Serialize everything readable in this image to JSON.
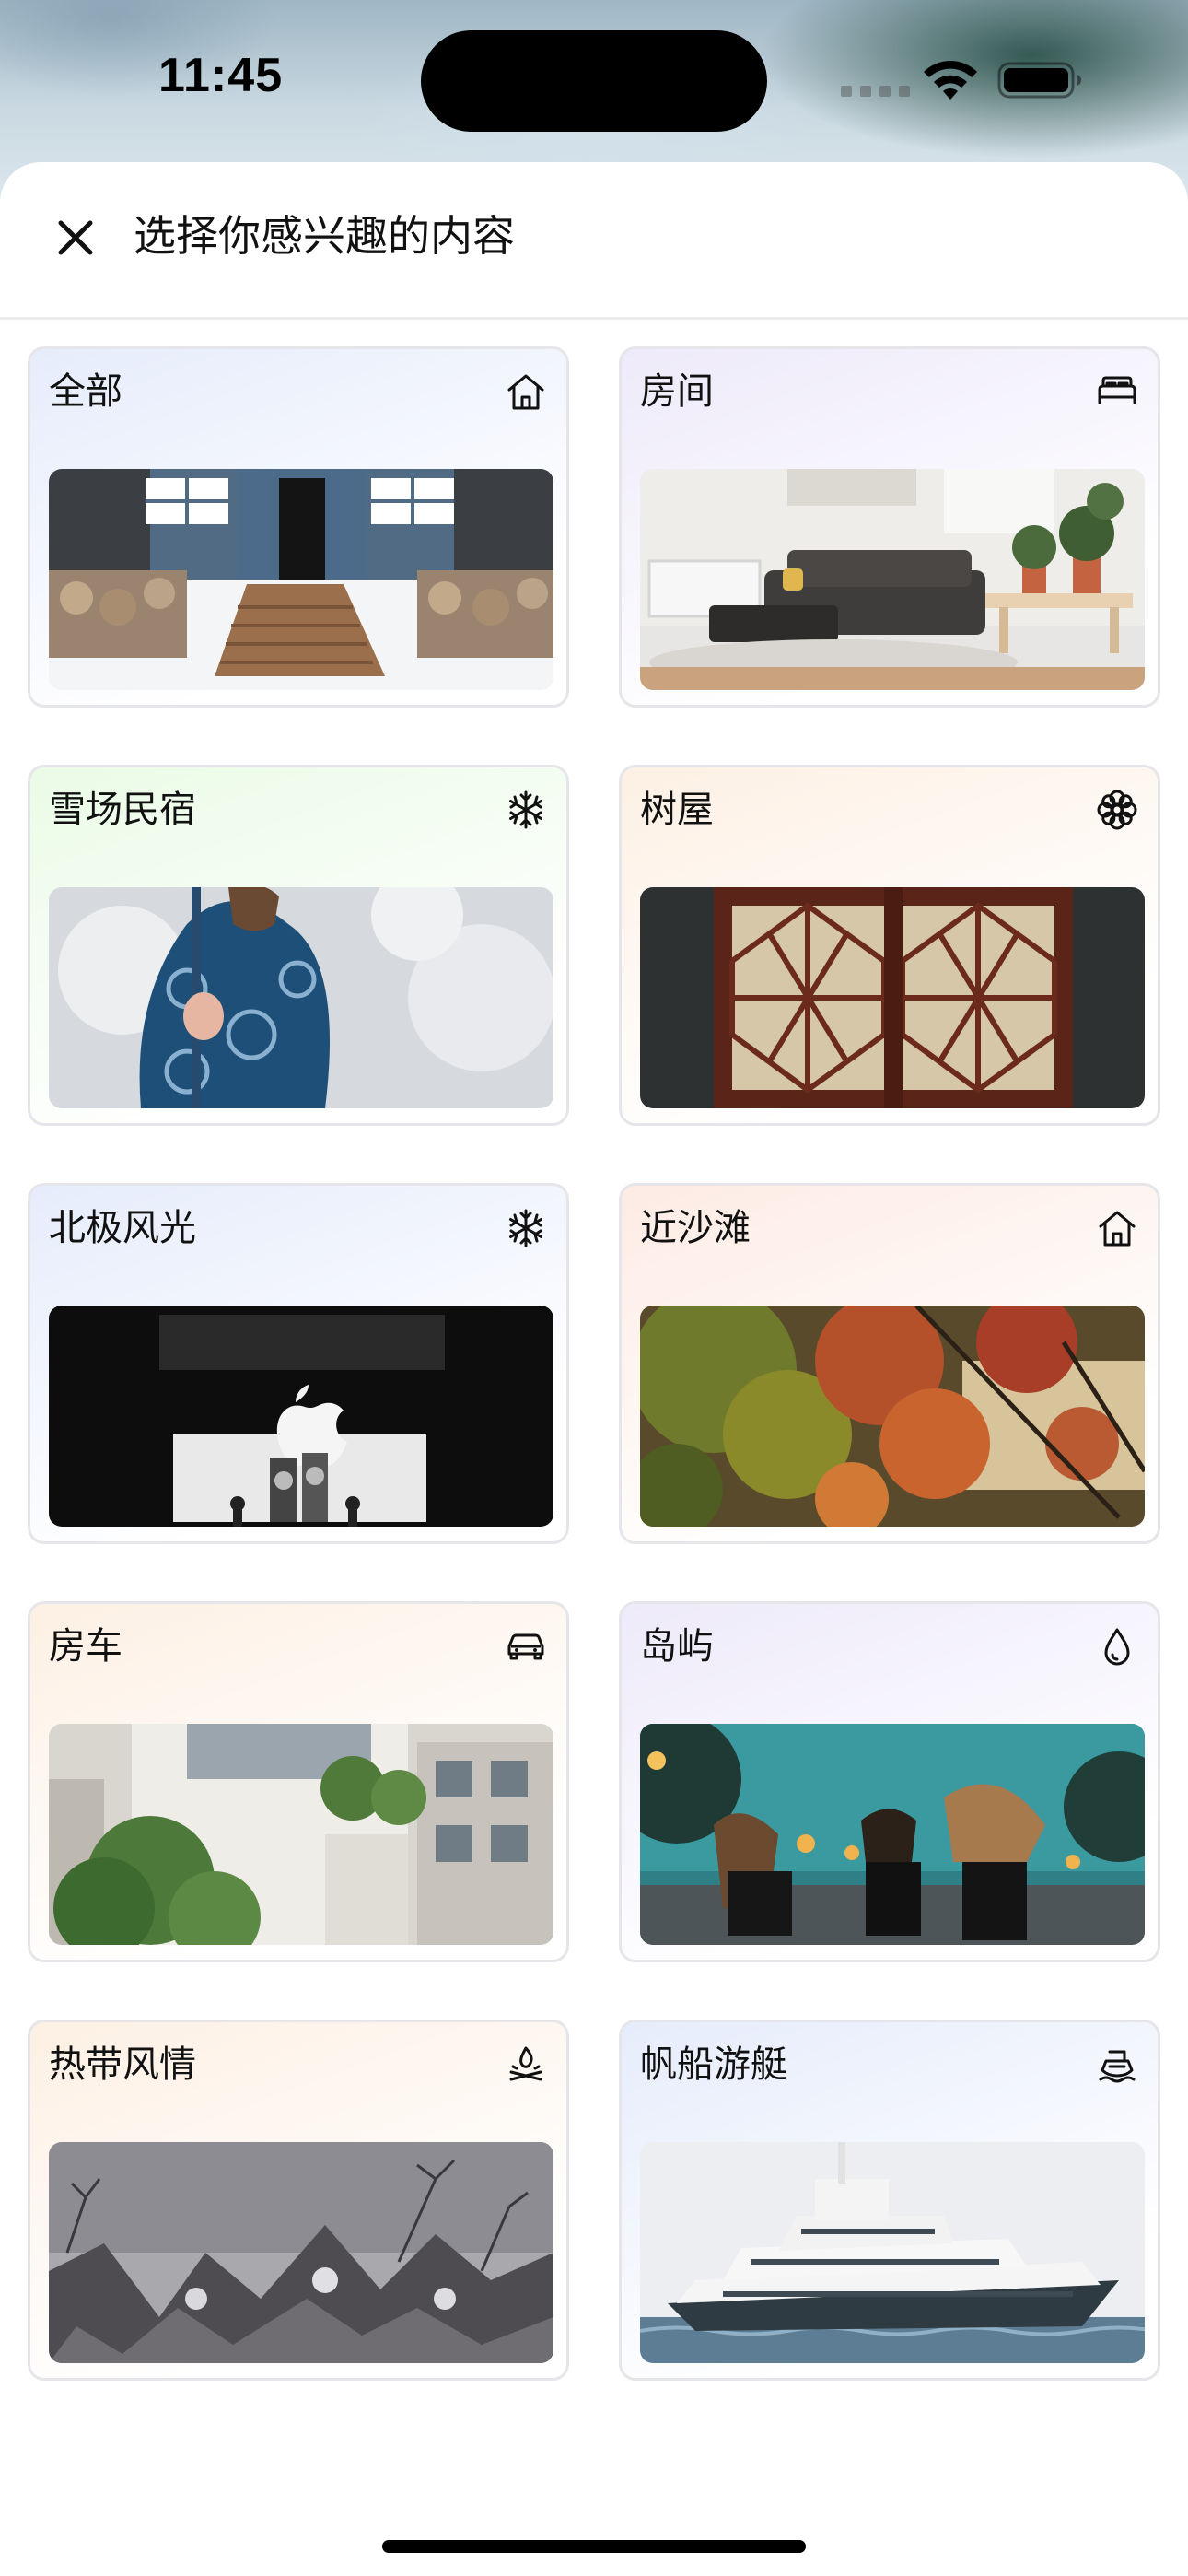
{
  "status_bar": {
    "time": "11:45",
    "wifi_icon": "wifi-icon",
    "battery_icon": "battery-icon"
  },
  "sheet": {
    "close_icon": "close-icon",
    "title": "选择你感兴趣的内容"
  },
  "categories": [
    {
      "label": "全部",
      "icon": "house-icon",
      "image": "snowy blue house with wooden steps",
      "bg": [
        "#e6ecfb",
        "#ffffff"
      ]
    },
    {
      "label": "房间",
      "icon": "bed-icon",
      "image": "living room with sofa and plants",
      "bg": [
        "#eeeafa",
        "#ffffff"
      ]
    },
    {
      "label": "雪场民宿",
      "icon": "snowflake-icon",
      "image": "person in patterned winter jacket",
      "bg": [
        "#eafbe6",
        "#ffffff"
      ]
    },
    {
      "label": "树屋",
      "icon": "flower-icon",
      "image": "red lattice wooden windows",
      "bg": [
        "#fdf0e4",
        "#ffffff"
      ]
    },
    {
      "label": "北极风光",
      "icon": "snowflake-icon",
      "image": "dark store with apple logo",
      "bg": [
        "#e6ecfb",
        "#ffffff"
      ]
    },
    {
      "label": "近沙滩",
      "icon": "house-icon",
      "image": "autumn trees at sunset",
      "bg": [
        "#fdebe4",
        "#ffffff"
      ]
    },
    {
      "label": "房车",
      "icon": "car-icon",
      "image": "modern building with palm tree",
      "bg": [
        "#fdf0e4",
        "#ffffff"
      ]
    },
    {
      "label": "岛屿",
      "icon": "drop-icon",
      "image": "three women sitting on street",
      "bg": [
        "#eeeafa",
        "#ffffff"
      ]
    },
    {
      "label": "热带风情",
      "icon": "campfire-icon",
      "image": "misty snowy mountains",
      "bg": [
        "#fdf0e4",
        "#ffffff"
      ]
    },
    {
      "label": "帆船游艇",
      "icon": "boat-icon",
      "image": "large white yacht on sea",
      "bg": [
        "#e6ecfb",
        "#ffffff"
      ]
    }
  ]
}
